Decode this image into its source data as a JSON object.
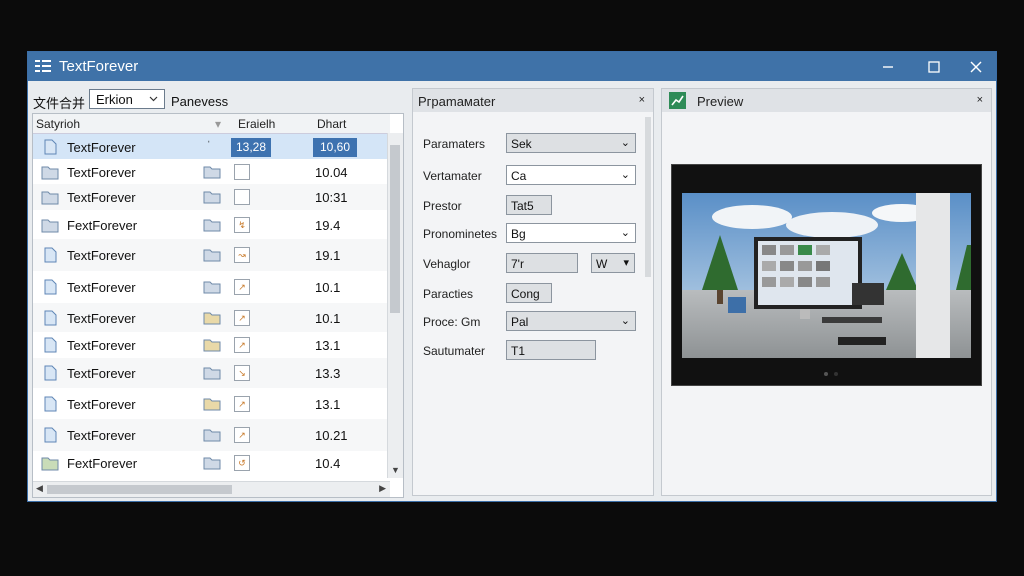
{
  "window": {
    "title": "TextForever"
  },
  "toolbar": {
    "label1": "文件合并",
    "combo_value": "Erkion",
    "label2": "Panevess"
  },
  "list": {
    "headers": [
      "Satyrioh",
      "Eraielh",
      "Dhart"
    ],
    "rows": [
      {
        "name": "TextForever",
        "c1": "ˈ",
        "thumb_val": "13,28",
        "value": "10,60",
        "selected": true
      },
      {
        "name": "TextForever",
        "value": "10.04"
      },
      {
        "name": "TextForever",
        "value": "10:31"
      },
      {
        "name": "FextForever",
        "value": "19.4"
      },
      {
        "name": "TextForever",
        "value": "19.1"
      },
      {
        "name": "TextForever",
        "value": "10.1"
      },
      {
        "name": "TextForever",
        "value": "10.1"
      },
      {
        "name": "TextForever",
        "value": "13.1"
      },
      {
        "name": "TextForever",
        "value": "13.3"
      },
      {
        "name": "TextForever",
        "value": "13.1"
      },
      {
        "name": "TextForever",
        "value": "10.21"
      },
      {
        "name": "FextForever",
        "value": "10.4"
      }
    ]
  },
  "params": {
    "title": "Pграmaмater",
    "close": "×",
    "fields": [
      {
        "label": "Paramaters",
        "value": "Sek"
      },
      {
        "label": "Vertamater",
        "value": "Ca"
      },
      {
        "label": "Prestor",
        "value": "Tat5"
      },
      {
        "label": "Pronominetes",
        "value": "Bg"
      },
      {
        "label": "Vehaglor",
        "value": "7'r",
        "extra": "W"
      },
      {
        "label": "Paracties",
        "value": "Cong"
      },
      {
        "label": "Proce: Gm",
        "value": "Pal"
      },
      {
        "label": "Sautumater",
        "value": "T1"
      }
    ]
  },
  "preview": {
    "title": "Preview",
    "close": "×"
  }
}
